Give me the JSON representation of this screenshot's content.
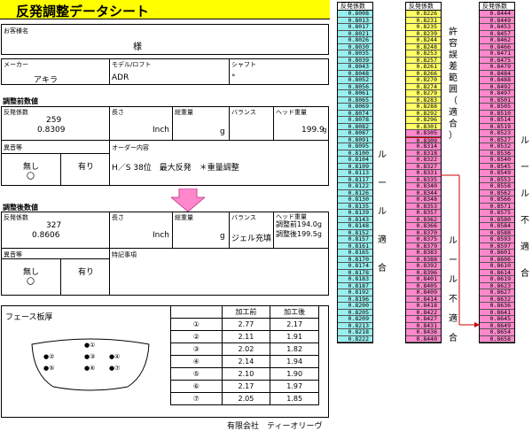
{
  "title": "反発調整データシート",
  "customer": {
    "label": "お客様名",
    "honorific": "様"
  },
  "maker": {
    "label": "メーカー",
    "value": "アキラ"
  },
  "model": {
    "label": "モデル/ロフト",
    "value": "ADR"
  },
  "shaft": {
    "label": "シャフト",
    "value": "°"
  },
  "before": {
    "title": "調整前数値",
    "coef_label": "反発係数",
    "coef_raw": "259",
    "coef_value": "0.8309",
    "length_label": "長さ",
    "length_unit": "Inch",
    "weight_label": "総重量",
    "weight_unit": "g",
    "balance_label": "バランス",
    "head_label": "ヘッド重量",
    "head_value": "199.9",
    "head_unit": "g",
    "sound_label": "異音等",
    "sound_no": "無し",
    "sound_no_mark": "〇",
    "sound_yes": "有り",
    "order_label": "オーダー内容",
    "order_text": "H／S 38位　最大反発　＊重量調整"
  },
  "after": {
    "title": "調整後数値",
    "coef_label": "反発係数",
    "coef_raw": "327",
    "coef_value": "0.8606",
    "length_label": "長さ",
    "length_unit": "Inch",
    "weight_label": "総重量",
    "weight_unit": "g",
    "balance_label": "バランス",
    "balance_value": "ジェル充填",
    "head_label": "ヘッド重量",
    "head_line1": "調整前194.0g",
    "head_line2": "調整後199.5g",
    "sound_label": "異音等",
    "sound_no": "無し",
    "sound_no_mark": "〇",
    "sound_yes": "有り",
    "notes_label": "特記事項"
  },
  "face": {
    "label": "フェース板厚",
    "headers": [
      "",
      "加工前",
      "加工後"
    ],
    "rows": [
      {
        "n": "①",
        "before": "2.77",
        "after": "2.17"
      },
      {
        "n": "②",
        "before": "2.11",
        "after": "1.91"
      },
      {
        "n": "③",
        "before": "2.02",
        "after": "1.82"
      },
      {
        "n": "④",
        "before": "2.14",
        "after": "1.94"
      },
      {
        "n": "⑤",
        "before": "2.10",
        "after": "1.90"
      },
      {
        "n": "⑥",
        "before": "2.17",
        "after": "1.97"
      },
      {
        "n": "⑦",
        "before": "2.05",
        "after": "1.85"
      }
    ],
    "points": {
      "p1": "●①",
      "p2": "●②",
      "p3": "●③",
      "p4": "●④",
      "p5": "●⑤",
      "p6": "●⑥",
      "p7": "●⑦"
    }
  },
  "company": "有限会社　ティーオリーヴ",
  "columns": {
    "header": "反発係数",
    "col1_values": [
      "0.8008",
      "0.8013",
      "0.8017",
      "0.8021",
      "0.8026",
      "0.8030",
      "0.8035",
      "0.8039",
      "0.8043",
      "0.8048",
      "0.8052",
      "0.8056",
      "0.8061",
      "0.8065",
      "0.8069",
      "0.8074",
      "0.8078",
      "0.8082",
      "0.8087",
      "0.8091",
      "0.8095",
      "0.8100",
      "0.8104",
      "0.8109",
      "0.8113",
      "0.8117",
      "0.8122",
      "0.8126",
      "0.8130",
      "0.8135",
      "0.8139",
      "0.8143",
      "0.8148",
      "0.8152",
      "0.8157",
      "0.8161",
      "0.8165",
      "0.8170",
      "0.8174",
      "0.8178",
      "0.8183",
      "0.8187",
      "0.8192",
      "0.8196",
      "0.8200",
      "0.8205",
      "0.8209",
      "0.8213",
      "0.8218",
      "0.8222"
    ],
    "col2_values": [
      "0.8226",
      "0.8231",
      "0.8235",
      "0.8239",
      "0.8244",
      "0.8248",
      "0.8253",
      "0.8257",
      "0.8261",
      "0.8266",
      "0.8270",
      "0.8274",
      "0.8279",
      "0.8283",
      "0.8288",
      "0.8292",
      "0.8296",
      "0.8301",
      "0.8305",
      "0.8309",
      "0.8314",
      "0.8318",
      "0.8322",
      "0.8327",
      "0.8331",
      "0.8335",
      "0.8340",
      "0.8344",
      "0.8348",
      "0.8353",
      "0.8357",
      "0.8362",
      "0.8366",
      "0.8370",
      "0.8375",
      "0.8379",
      "0.8383",
      "0.8388",
      "0.8392",
      "0.8396",
      "0.8401",
      "0.8405",
      "0.8409",
      "0.8414",
      "0.8418",
      "0.8422",
      "0.8427",
      "0.8431",
      "0.8436",
      "0.8440"
    ],
    "col3_values": [
      "0.8444",
      "0.8449",
      "0.8453",
      "0.8457",
      "0.8462",
      "0.8466",
      "0.8471",
      "0.8475",
      "0.8479",
      "0.8484",
      "0.8488",
      "0.8492",
      "0.8497",
      "0.8501",
      "0.8505",
      "0.8510",
      "0.8514",
      "0.8519",
      "0.8523",
      "0.8527",
      "0.8532",
      "0.8536",
      "0.8540",
      "0.8545",
      "0.8549",
      "0.8553",
      "0.8558",
      "0.8562",
      "0.8566",
      "0.8571",
      "0.8575",
      "0.8580",
      "0.8584",
      "0.8588",
      "0.8593",
      "0.8597",
      "0.8601",
      "0.8606",
      "0.8610",
      "0.8614",
      "0.8619",
      "0.8623",
      "0.8627",
      "0.8632",
      "0.8636",
      "0.8641",
      "0.8645",
      "0.8649",
      "0.8654",
      "0.8658"
    ],
    "col1_label": "ルール適合",
    "col2_label_yellow": "許容誤差範囲（適合）",
    "col2_label_pink": "ルール不適合",
    "col3_label": "ルール不適合",
    "colors": {
      "cyan": "#99eeee",
      "yellow": "#ffff66",
      "pink": "#ff88cc",
      "arrow": "#cc0000",
      "shape_arrow": "#ff88cc"
    }
  }
}
